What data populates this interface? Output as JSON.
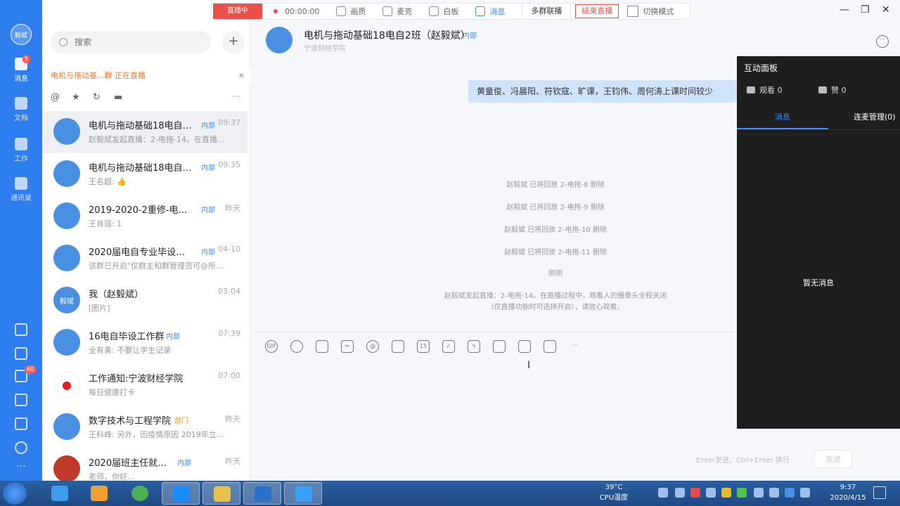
{
  "rail": {
    "avatar_text": "毅斌",
    "items": [
      {
        "label": "消息",
        "badge": "5"
      },
      {
        "label": "文档"
      },
      {
        "label": "工作"
      },
      {
        "label": "通讯录"
      }
    ],
    "bottom_badge": "60"
  },
  "topbar": {
    "live_label": "直播中",
    "timer": "00:00:00",
    "buttons": [
      "画质",
      "麦克",
      "白板",
      "消息"
    ],
    "multi_group": "多群联播",
    "end_live": "结束直播",
    "switch_mode": "切换模式"
  },
  "list": {
    "search_placeholder": "搜索",
    "live_notice": "电机与拖动基...群 正在直播",
    "conversations": [
      {
        "name": "电机与拖动基础18电自2...",
        "tag": "内部",
        "time": "09:37",
        "preview": "赵毅斌发起直播：2-电拖-14。在直播..."
      },
      {
        "name": "电机与拖动基础18电自1...",
        "tag": "内部",
        "time": "09:35",
        "preview": "王名超: 👍"
      },
      {
        "name": "2019-2020-2重修-电机...",
        "tag": "内部",
        "time": "昨天",
        "preview": "王肖瑶: 1"
      },
      {
        "name": "2020届电自专业毕设答辩...",
        "tag": "内部",
        "time": "04-10",
        "preview": "该群已开启\"仅群主和群管理员可@所..."
      },
      {
        "name": "我（赵毅斌）",
        "tag": "",
        "time": "03-04",
        "preview": "[图片]",
        "avatar": "毅斌"
      },
      {
        "name": "16电自毕设工作群",
        "tag": "内部",
        "time": "07:39",
        "preview": "全有勇: 不要让学生记录"
      },
      {
        "name": "工作通知:宁波财经学院",
        "tag": "",
        "time": "07:00",
        "preview": "每日健康打卡"
      },
      {
        "name": "数字技术与工程学院",
        "tag": "部门",
        "time": "昨天",
        "preview": "王科峰: 另外，因疫情原因 2019年立..."
      },
      {
        "name": "2020届班主任就业群",
        "tag": "内部",
        "time": "昨天",
        "preview": "老师，你好..."
      }
    ]
  },
  "chat": {
    "title": "电机与拖动基础18电自2班（赵毅斌）",
    "title_tag": "内部",
    "subtitle": "宁波财经学院",
    "bubble": "黄童俊、冯晨阳、符钦寇、旷课，王钧伟、周何涛上课时间较少",
    "system_messages": [
      "赵毅斌 已将回放 2-电拖-8 删除",
      "赵毅斌 已将回放 2-电拖-9 删除",
      "赵毅斌 已将回放 2-电拖-10 删除",
      "赵毅斌 已将回放 2-电拖-11 删除",
      "刚刚",
      "赵毅斌发起直播：2-电拖-14。在直播过程中，观看人的摄像头全程关闭",
      "（仅直播功能时可选择开启），请放心观看。"
    ],
    "hint": "Enter发送，Ctrl+Enter 换行",
    "send": "发送"
  },
  "interaction": {
    "title": "互动面板",
    "viewers": "观看 0",
    "likes": "赞 0",
    "tab_messages": "消息",
    "tab_mic": "连麦管理(0)",
    "empty": "暂无消息"
  },
  "taskbar": {
    "cpu_temp": "39°C",
    "cpu_label": "CPU温度",
    "time": "9:37",
    "date": "2020/4/15"
  }
}
